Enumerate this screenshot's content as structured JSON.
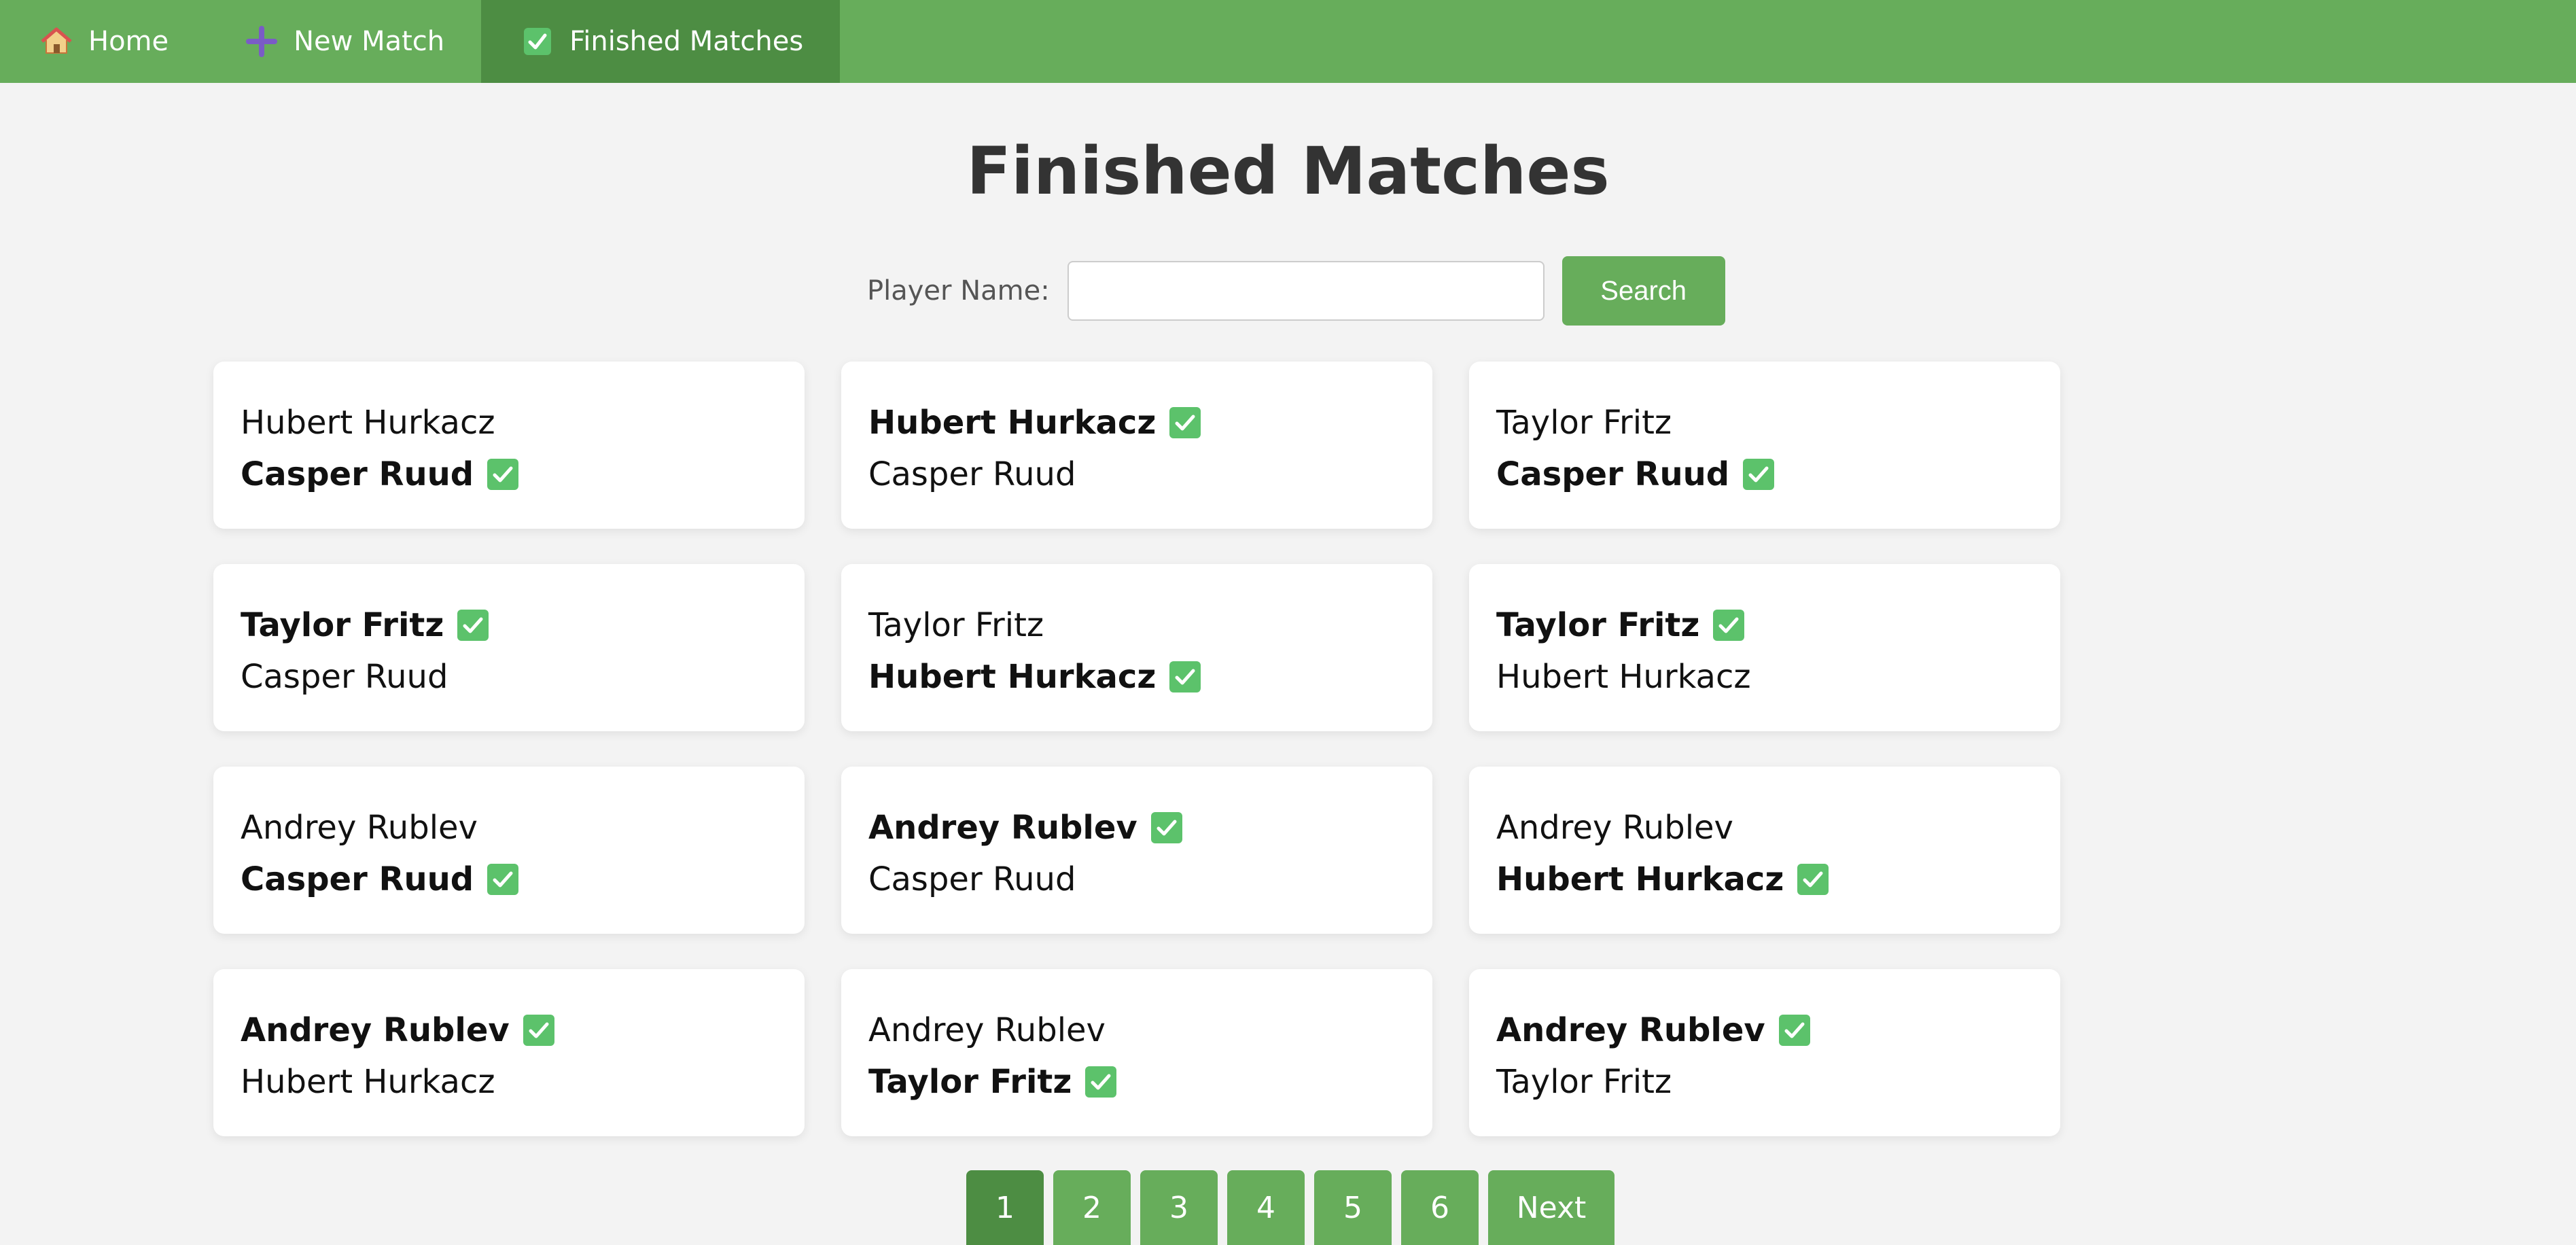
{
  "nav": {
    "items": [
      {
        "label": "Home",
        "icon": "house-icon"
      },
      {
        "label": "New Match",
        "icon": "plus-icon"
      },
      {
        "label": "Finished Matches",
        "icon": "check-icon",
        "active": true
      }
    ]
  },
  "page": {
    "title": "Finished Matches"
  },
  "search": {
    "label": "Player Name:",
    "value": "",
    "button_label": "Search"
  },
  "matches": [
    {
      "player1": "Hubert Hurkacz",
      "player2": "Casper Ruud",
      "winner": 2
    },
    {
      "player1": "Hubert Hurkacz",
      "player2": "Casper Ruud",
      "winner": 1
    },
    {
      "player1": "Taylor Fritz",
      "player2": "Casper Ruud",
      "winner": 2
    },
    {
      "player1": "Taylor Fritz",
      "player2": "Casper Ruud",
      "winner": 1
    },
    {
      "player1": "Taylor Fritz",
      "player2": "Hubert Hurkacz",
      "winner": 2
    },
    {
      "player1": "Taylor Fritz",
      "player2": "Hubert Hurkacz",
      "winner": 1
    },
    {
      "player1": "Andrey Rublev",
      "player2": "Casper Ruud",
      "winner": 2
    },
    {
      "player1": "Andrey Rublev",
      "player2": "Casper Ruud",
      "winner": 1
    },
    {
      "player1": "Andrey Rublev",
      "player2": "Hubert Hurkacz",
      "winner": 2
    },
    {
      "player1": "Andrey Rublev",
      "player2": "Hubert Hurkacz",
      "winner": 1
    },
    {
      "player1": "Andrey Rublev",
      "player2": "Taylor Fritz",
      "winner": 2
    },
    {
      "player1": "Andrey Rublev",
      "player2": "Taylor Fritz",
      "winner": 1
    }
  ],
  "pagination": {
    "pages": [
      "1",
      "2",
      "3",
      "4",
      "5",
      "6"
    ],
    "current": "1",
    "next_label": "Next"
  },
  "colors": {
    "nav": "#67ad5b",
    "nav_active": "#4d8d43",
    "check": "#5cc26b",
    "background": "#f3f3f3"
  }
}
